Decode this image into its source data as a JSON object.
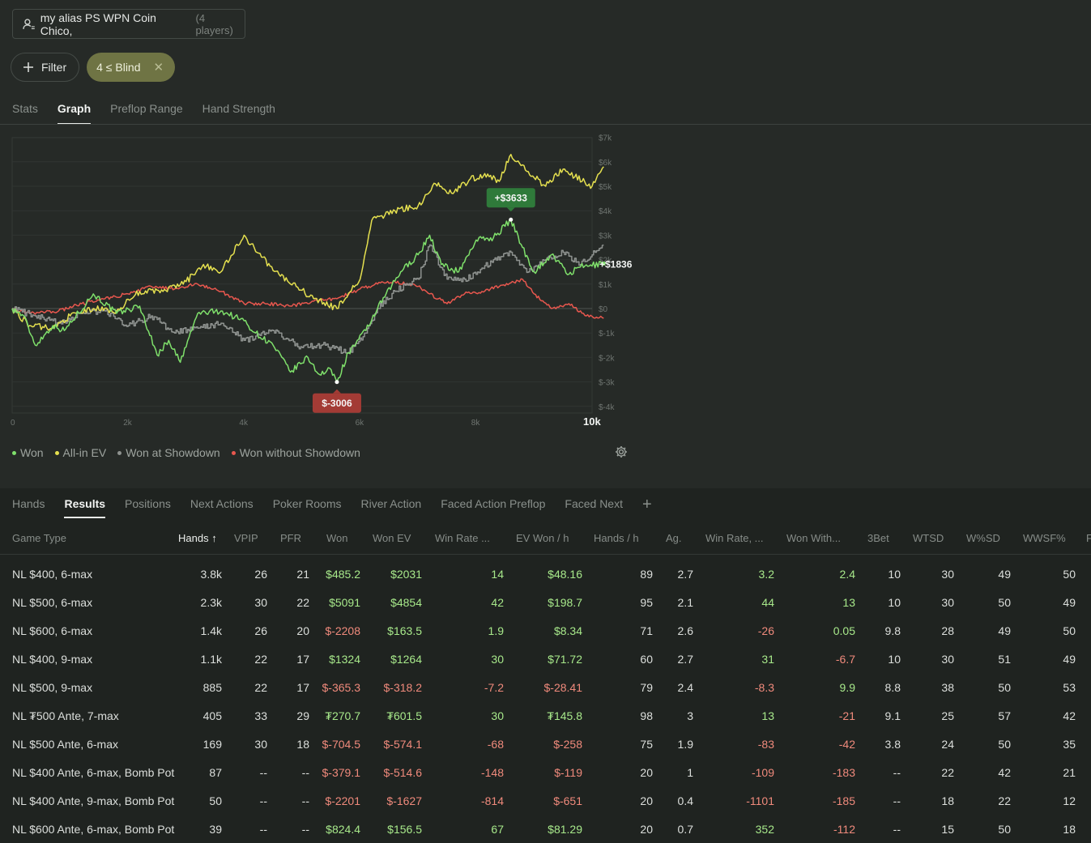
{
  "player": {
    "name": "my alias PS WPN Coin Chico,",
    "count": "(4 players)"
  },
  "filters": {
    "filter_label": "Filter",
    "active_chip": "4 ≤ Blind"
  },
  "top_tabs": [
    "Stats",
    "Graph",
    "Preflop Range",
    "Hand Strength"
  ],
  "top_tab_active": "Graph",
  "chart_data": {
    "type": "line",
    "x_ticks": [
      "0",
      "2k",
      "4k",
      "6k",
      "8k",
      "10k"
    ],
    "y_ticks": [
      "$7k",
      "$6k",
      "$5k",
      "$4k",
      "$3k",
      "$2k",
      "$1k",
      "$0",
      "$-1k",
      "$-2k",
      "$-3k",
      "$-4k"
    ],
    "xlim": [
      0,
      10200
    ],
    "ylim": [
      -4000,
      7000
    ],
    "grid": true,
    "legend": "bottom",
    "series": [
      {
        "name": "Won",
        "color": "#7fe06b",
        "points": [
          [
            0,
            0
          ],
          [
            200,
            -300
          ],
          [
            400,
            -1500
          ],
          [
            700,
            -700
          ],
          [
            900,
            -900
          ],
          [
            1400,
            600
          ],
          [
            1800,
            -200
          ],
          [
            2200,
            100
          ],
          [
            2500,
            -1900
          ],
          [
            2700,
            -1300
          ],
          [
            2900,
            -2200
          ],
          [
            3200,
            -200
          ],
          [
            3600,
            -100
          ],
          [
            4000,
            -500
          ],
          [
            4200,
            -1000
          ],
          [
            4500,
            -1500
          ],
          [
            4800,
            -2600
          ],
          [
            5100,
            -2000
          ],
          [
            5300,
            -2700
          ],
          [
            5500,
            -2500
          ],
          [
            5600,
            -3006
          ],
          [
            5800,
            -1800
          ],
          [
            6100,
            -900
          ],
          [
            6300,
            0
          ],
          [
            6700,
            1500
          ],
          [
            7000,
            2200
          ],
          [
            7200,
            3000
          ],
          [
            7400,
            1800
          ],
          [
            7700,
            1500
          ],
          [
            8000,
            2800
          ],
          [
            8300,
            2900
          ],
          [
            8600,
            3633
          ],
          [
            8800,
            2500
          ],
          [
            9000,
            1500
          ],
          [
            9300,
            2200
          ],
          [
            9600,
            1400
          ],
          [
            9800,
            1700
          ],
          [
            10200,
            1836
          ]
        ]
      },
      {
        "name": "All-in EV",
        "color": "#e5e04f",
        "points": [
          [
            0,
            0
          ],
          [
            300,
            -700
          ],
          [
            700,
            -800
          ],
          [
            1000,
            -300
          ],
          [
            1400,
            0
          ],
          [
            1800,
            -100
          ],
          [
            2200,
            700
          ],
          [
            2600,
            700
          ],
          [
            3000,
            1100
          ],
          [
            3300,
            1800
          ],
          [
            3600,
            1500
          ],
          [
            4000,
            3000
          ],
          [
            4300,
            2100
          ],
          [
            4600,
            1400
          ],
          [
            4900,
            900
          ],
          [
            5200,
            400
          ],
          [
            5600,
            0
          ],
          [
            6000,
            1200
          ],
          [
            6200,
            3600
          ],
          [
            6600,
            4000
          ],
          [
            7000,
            4200
          ],
          [
            7300,
            5100
          ],
          [
            7600,
            4700
          ],
          [
            7900,
            5300
          ],
          [
            8200,
            5500
          ],
          [
            8400,
            5200
          ],
          [
            8600,
            6300
          ],
          [
            8900,
            5600
          ],
          [
            9200,
            5000
          ],
          [
            9500,
            5700
          ],
          [
            10000,
            5000
          ],
          [
            10200,
            5800
          ]
        ]
      },
      {
        "name": "Won at Showdown",
        "color": "#8e928f",
        "points": [
          [
            0,
            0
          ],
          [
            400,
            -300
          ],
          [
            800,
            -600
          ],
          [
            1200,
            -200
          ],
          [
            1600,
            -100
          ],
          [
            2000,
            -700
          ],
          [
            2400,
            -300
          ],
          [
            2800,
            -1000
          ],
          [
            3200,
            -800
          ],
          [
            3600,
            -600
          ],
          [
            4000,
            -1300
          ],
          [
            4500,
            -900
          ],
          [
            5000,
            -1600
          ],
          [
            5400,
            -1500
          ],
          [
            5800,
            -1800
          ],
          [
            6100,
            -1000
          ],
          [
            6300,
            0
          ],
          [
            6600,
            700
          ],
          [
            7000,
            1200
          ],
          [
            7200,
            2600
          ],
          [
            7500,
            1200
          ],
          [
            7800,
            1200
          ],
          [
            8000,
            1400
          ],
          [
            8300,
            2000
          ],
          [
            8600,
            2300
          ],
          [
            8900,
            1500
          ],
          [
            9200,
            2000
          ],
          [
            9500,
            2300
          ],
          [
            9800,
            1800
          ],
          [
            10200,
            2600
          ]
        ]
      },
      {
        "name": "Won without Showdown",
        "color": "#e8574e",
        "points": [
          [
            0,
            0
          ],
          [
            300,
            -200
          ],
          [
            800,
            -100
          ],
          [
            1200,
            200
          ],
          [
            1600,
            400
          ],
          [
            2000,
            600
          ],
          [
            2400,
            900
          ],
          [
            2800,
            800
          ],
          [
            3200,
            1000
          ],
          [
            3600,
            700
          ],
          [
            4000,
            200
          ],
          [
            4400,
            200
          ],
          [
            4800,
            100
          ],
          [
            5200,
            300
          ],
          [
            5600,
            400
          ],
          [
            6000,
            800
          ],
          [
            6300,
            1000
          ],
          [
            6600,
            1100
          ],
          [
            7000,
            900
          ],
          [
            7200,
            600
          ],
          [
            7500,
            200
          ],
          [
            7800,
            600
          ],
          [
            8100,
            700
          ],
          [
            8400,
            900
          ],
          [
            8800,
            1200
          ],
          [
            9000,
            600
          ],
          [
            9300,
            0
          ],
          [
            9600,
            200
          ],
          [
            9900,
            -300
          ],
          [
            10200,
            -400
          ]
        ]
      }
    ],
    "annotations": [
      {
        "label": "+$3633",
        "x": 8600,
        "y": 3633,
        "color": "#2f7a3a"
      },
      {
        "label": "$-3006",
        "x": 5600,
        "y": -3006,
        "color": "#a33b35"
      }
    ],
    "end_label": "+$1836",
    "end_value": 1836
  },
  "legend": [
    {
      "label": "Won",
      "color": "#7fe06b"
    },
    {
      "label": "All-in EV",
      "color": "#e5e04f"
    },
    {
      "label": "Won at Showdown",
      "color": "#8e928f"
    },
    {
      "label": "Won without Showdown",
      "color": "#e8574e"
    }
  ],
  "bottom_tabs": [
    "Hands",
    "Results",
    "Positions",
    "Next Actions",
    "Poker Rooms",
    "River Action",
    "Faced Action Preflop",
    "Faced Next"
  ],
  "bottom_tab_active": "Results",
  "table": {
    "columns": [
      "Game Type",
      "Hands ↑",
      "VPIP",
      "PFR",
      "Won",
      "Won EV",
      "Win Rate ...",
      "EV Won / h",
      "Hands / h",
      "Ag.",
      "Win Rate, ...",
      "Won With...",
      "3Bet",
      "WTSD",
      "W%SD",
      "WWSF%"
    ],
    "rows": [
      [
        "NL $400, 6-max",
        "3.8k",
        "26",
        "21",
        "$485.2",
        "$2031",
        "14",
        "$48.16",
        "89",
        "2.7",
        "3.2",
        "2.4",
        "10",
        "30",
        "49",
        "50"
      ],
      [
        "NL $500, 6-max",
        "2.3k",
        "30",
        "22",
        "$5091",
        "$4854",
        "42",
        "$198.7",
        "95",
        "2.1",
        "44",
        "13",
        "10",
        "30",
        "50",
        "49"
      ],
      [
        "NL $600, 6-max",
        "1.4k",
        "26",
        "20",
        "$-2208",
        "$163.5",
        "1.9",
        "$8.34",
        "71",
        "2.6",
        "-26",
        "0.05",
        "9.8",
        "28",
        "49",
        "50"
      ],
      [
        "NL $400, 9-max",
        "1.1k",
        "22",
        "17",
        "$1324",
        "$1264",
        "30",
        "$71.72",
        "60",
        "2.7",
        "31",
        "-6.7",
        "10",
        "30",
        "51",
        "49"
      ],
      [
        "NL $500, 9-max",
        "885",
        "22",
        "17",
        "$-365.3",
        "$-318.2",
        "-7.2",
        "$-28.41",
        "79",
        "2.4",
        "-8.3",
        "9.9",
        "8.8",
        "38",
        "50",
        "53"
      ],
      [
        "NL ₮500 Ante, 7-max",
        "405",
        "33",
        "29",
        "₮270.7",
        "₮601.5",
        "30",
        "₮145.8",
        "98",
        "3",
        "13",
        "-21",
        "9.1",
        "25",
        "57",
        "42"
      ],
      [
        "NL $500 Ante, 6-max",
        "169",
        "30",
        "18",
        "$-704.5",
        "$-574.1",
        "-68",
        "$-258",
        "75",
        "1.9",
        "-83",
        "-42",
        "3.8",
        "24",
        "50",
        "35"
      ],
      [
        "NL $400 Ante, 6-max, Bomb Pot",
        "87",
        "--",
        "--",
        "$-379.1",
        "$-514.6",
        "-148",
        "$-119",
        "20",
        "1",
        "-109",
        "-183",
        "--",
        "22",
        "42",
        "21"
      ],
      [
        "NL $400 Ante, 9-max, Bomb Pot",
        "50",
        "--",
        "--",
        "$-2201",
        "$-1627",
        "-814",
        "$-651",
        "20",
        "0.4",
        "-1101",
        "-185",
        "--",
        "18",
        "22",
        "12"
      ],
      [
        "NL $600 Ante, 6-max, Bomb Pot",
        "39",
        "--",
        "--",
        "$824.4",
        "$156.5",
        "67",
        "$81.29",
        "20",
        "0.7",
        "352",
        "-112",
        "--",
        "15",
        "50",
        "18"
      ]
    ]
  }
}
